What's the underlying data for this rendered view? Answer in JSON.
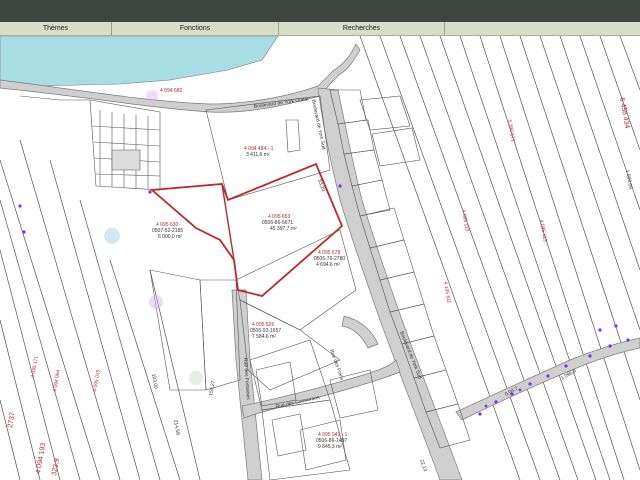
{
  "menu": {
    "themes": "Thèmes",
    "fonctions": "Fonctions",
    "recherches": "Recherches"
  },
  "colors": {
    "water": "#a7dde3",
    "road": "#cfcfcf",
    "road_edge": "#7a7a7a",
    "lot_line": "#555555",
    "selection": "#c0262a",
    "lot_number": "#c0262a",
    "survey_points": "#8a2be2"
  },
  "streets": {
    "york_ouest": "Boulevard de York Ouest",
    "york_sud": "Boulevard de York Sud",
    "york_sud_lower": "Boulevard de York Sud",
    "rue_fontaines": "Rue des Fontaines",
    "rue_cormorans": "Rue des Cormorans",
    "rue_des_foins": "Rue des Foins"
  },
  "lots": {
    "top_left": "4 094 680",
    "top_center": "4 094 484 - 1",
    "selected_main": "4 095 653",
    "left_big": "4 095 630",
    "center_south": "4 095 678",
    "south_mid": "4 095 526",
    "bottom_mid": "4 095 941 - 1",
    "bottom_left": "4 094 193",
    "right_edge": "6 458 434",
    "right_a": "5 390 571",
    "right_b": "4 095 113",
    "right_c": "4 195 611",
    "right_d": "4 095 413",
    "left_a": "4 095 171",
    "left_b": "4 094 094",
    "left_c": "4 095 015"
  },
  "areas": {
    "top_center": "3 411,6 m²",
    "selected_main": "45 397,7 m²",
    "left_big": "6 000,0 m²",
    "center_south": "4 694,6 m²",
    "south_mid": "7 584,6 m²",
    "bottom_mid": "9 845,3 m²"
  },
  "dimensions": {
    "d1": "214,58",
    "d2": "1 093,09",
    "d3": "53,20",
    "d4": "103,09",
    "d5": "1 096,9",
    "d6": "22,13",
    "d7": "150,27",
    "d8": "2737",
    "d9": "323,9",
    "d10": "0,04,7"
  },
  "codes": {
    "c1": "0506-86-5671",
    "c2": "0506-76-2780",
    "c3": "0507-52-2185",
    "c4": "0506-93-1657",
    "c5": "0506-86-1407"
  }
}
